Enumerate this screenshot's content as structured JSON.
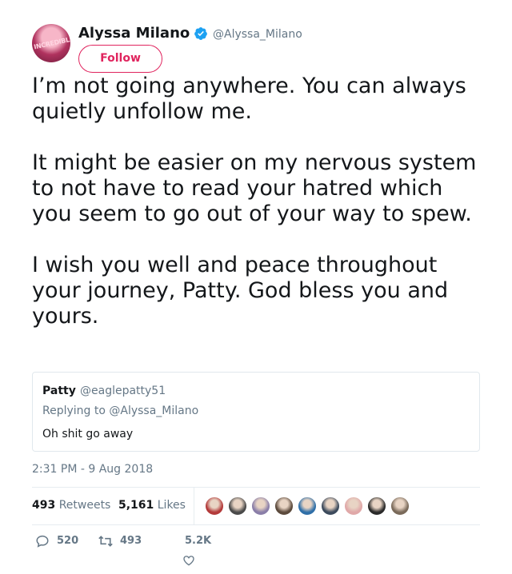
{
  "author": {
    "name": "Alyssa Milano",
    "handle": "@Alyssa_Milano",
    "avatar_text": "INCREDIBLES",
    "verified": true
  },
  "follow_button": {
    "label": "Follow"
  },
  "tweet": {
    "text": "I’m not going anywhere. You can always quietly unfollow me.\n\nIt might be easier on my nervous system to not have to read your hatred which you seem to go out of your way to spew.\n\nI wish you well and peace throughout your journey, Patty. God bless you and yours.",
    "timestamp": "2:31 PM - 9 Aug 2018"
  },
  "quoted_tweet": {
    "name": "Patty",
    "handle": "@eaglepatty51",
    "replying_to": "Replying to @Alyssa_Milano",
    "text": "Oh shit go away"
  },
  "stats": {
    "retweets_count": "493",
    "retweets_label": "Retweets",
    "likes_count": "5,161",
    "likes_label": "Likes"
  },
  "liker_avatars": [
    {
      "icon": "liker-avatar",
      "color": "#b33a3a"
    },
    {
      "icon": "liker-avatar",
      "color": "#4a4a4a"
    },
    {
      "icon": "liker-avatar",
      "color": "#8a7ea8"
    },
    {
      "icon": "liker-avatar",
      "color": "#5c4a3c"
    },
    {
      "icon": "liker-avatar",
      "color": "#2f6fa8"
    },
    {
      "icon": "liker-avatar",
      "color": "#3c4a5c"
    },
    {
      "icon": "liker-avatar",
      "color": "#e0a8a8"
    },
    {
      "icon": "liker-avatar",
      "color": "#2a2a2a"
    },
    {
      "icon": "liker-avatar",
      "color": "#7a6a5a"
    }
  ],
  "actions": {
    "reply_count": "520",
    "retweet_count": "493",
    "like_count": "5.2K"
  },
  "colors": {
    "accent_pink": "#e0245e",
    "verified_blue": "#1da1f2",
    "muted_gray": "#657786",
    "text": "#14171a"
  }
}
